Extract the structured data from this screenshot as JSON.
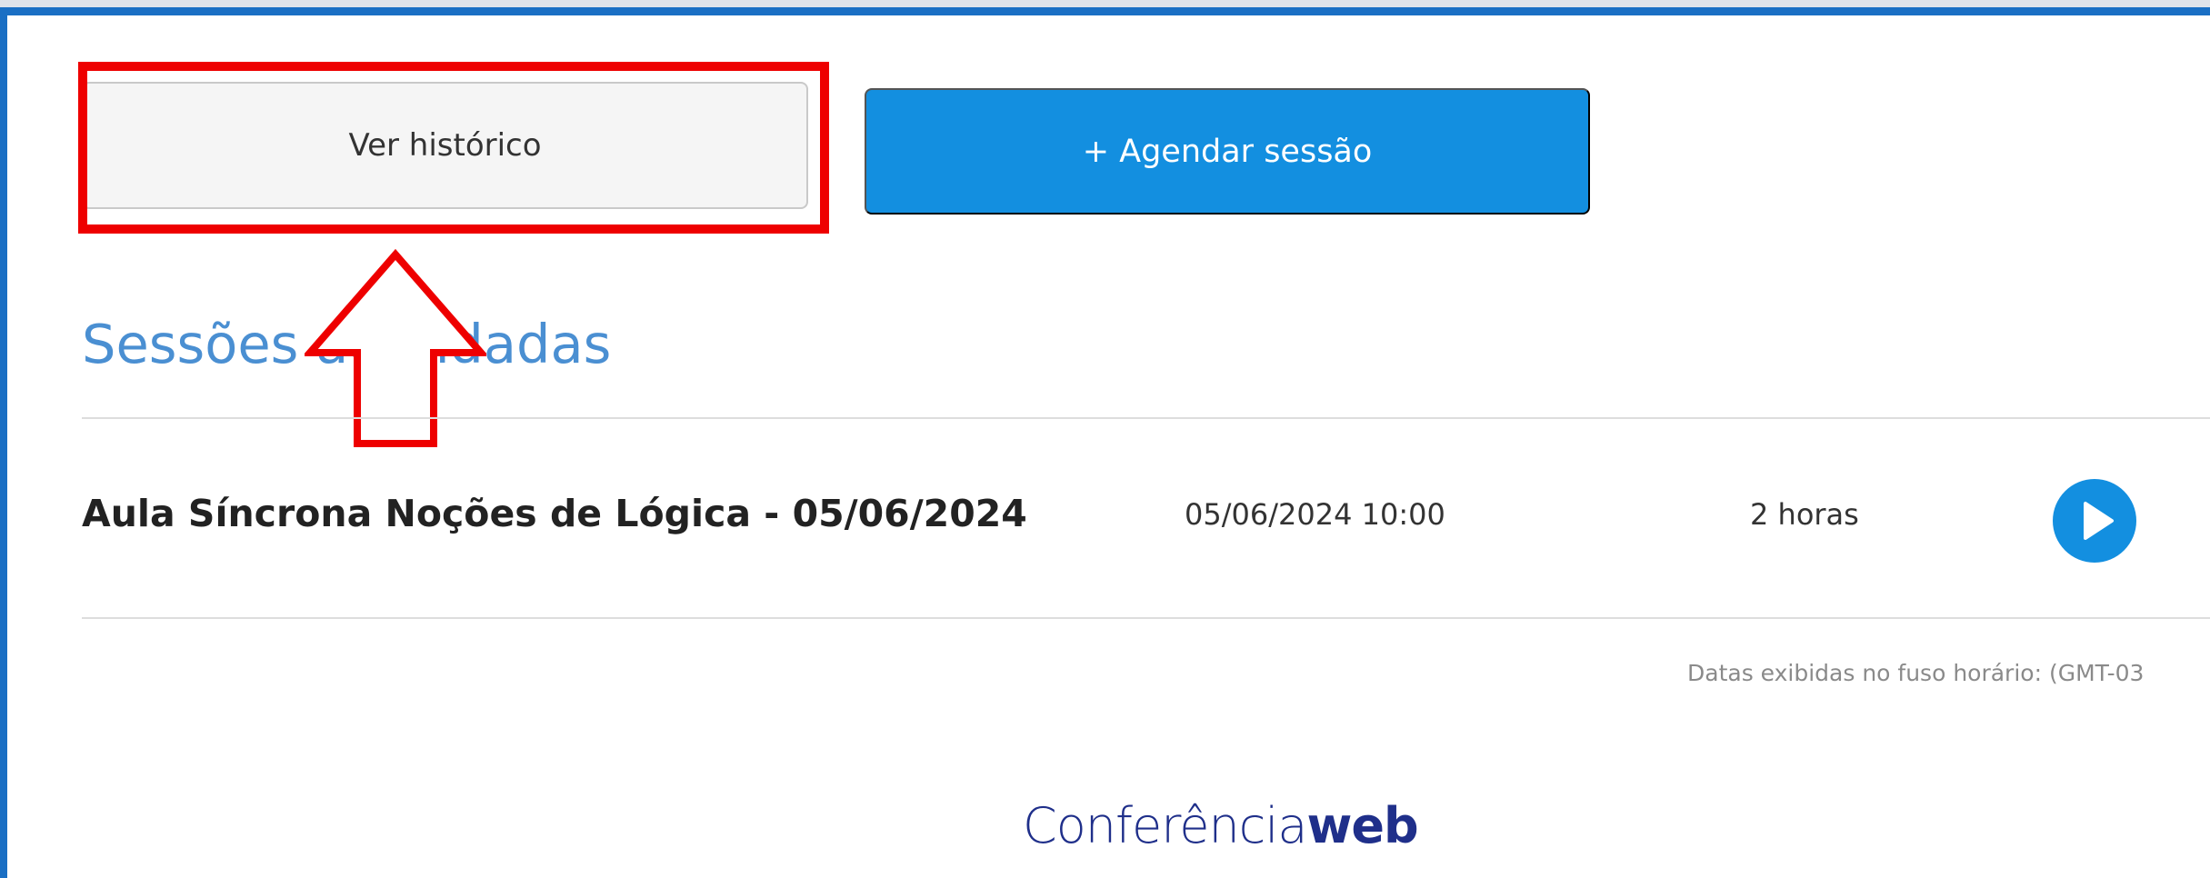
{
  "actions": {
    "history_label": "Ver histórico",
    "schedule_label": "+ Agendar sessão"
  },
  "section": {
    "title": "Sessões agendadas"
  },
  "sessions": [
    {
      "title": "Aula Síncrona Noções de Lógica - 05/06/2024",
      "datetime": "05/06/2024 10:00",
      "duration": "2 horas"
    }
  ],
  "footer": {
    "timezone_note": "Datas exibidas no fuso horário: (GMT-03",
    "logo_light": "Conferência",
    "logo_bold": "web"
  },
  "icons": {
    "play": "play-icon",
    "annotation_arrow": "up-arrow-icon"
  },
  "colors": {
    "primary": "#138fe0",
    "frame": "#1a6fc4",
    "highlight": "#ee0000",
    "section_title": "#4a8fd2",
    "logo": "#1f2f8a"
  }
}
